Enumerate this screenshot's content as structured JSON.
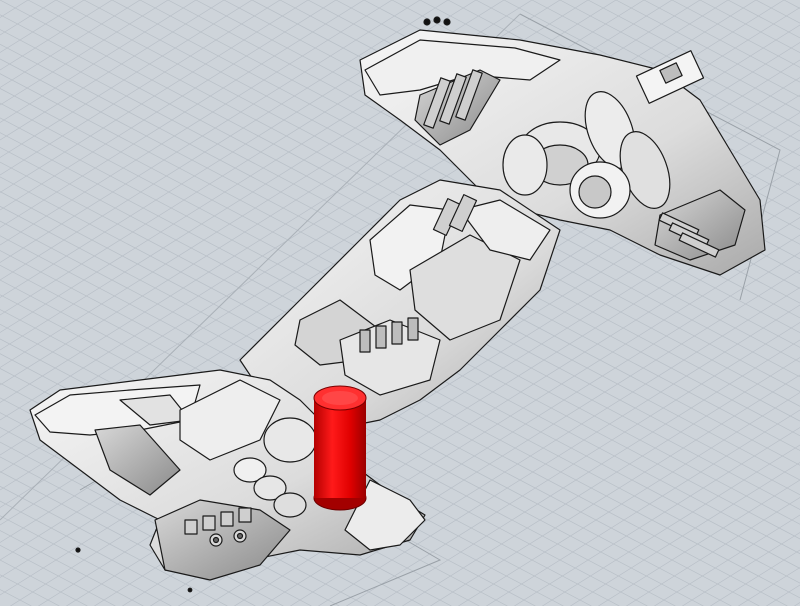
{
  "viewport": {
    "background_color": "#ced4da",
    "grid_color": "#b8bfc7",
    "model_color": "#e4e6e8",
    "edge_color": "#1a1a1a",
    "highlight_color": "#e60000",
    "selected_part": "red-cylinder"
  }
}
